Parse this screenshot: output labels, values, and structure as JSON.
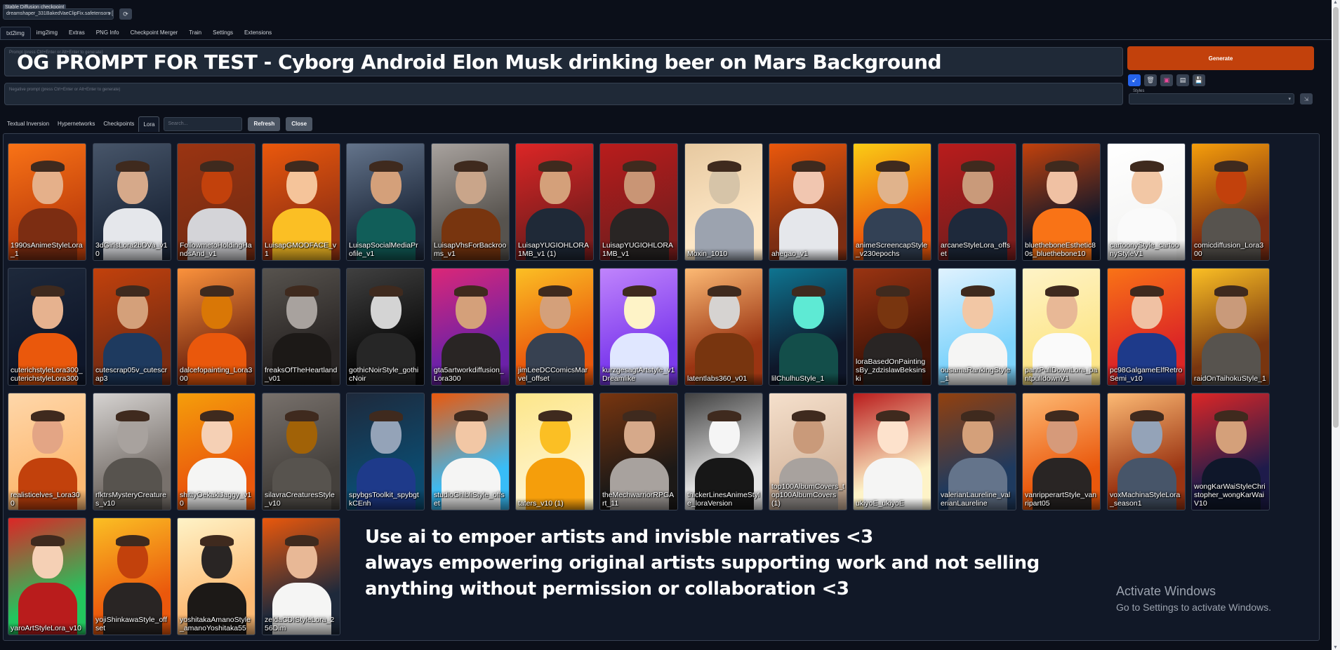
{
  "checkpoint": {
    "label": "Stable Diffusion checkpoint",
    "value": "dreamshaper_331BakedVaeClipFix.safetensors [",
    "refresh_icon": "refresh-icon"
  },
  "tabs": [
    "txt2img",
    "img2img",
    "Extras",
    "PNG Info",
    "Checkpoint Merger",
    "Train",
    "Settings",
    "Extensions"
  ],
  "prompt": {
    "placeholder": "Prompt (press Ctrl+Enter or Alt+Enter to generate)",
    "overlay_text": "OG PROMPT FOR TEST - Cyborg Android Elon Musk drinking beer on Mars Background"
  },
  "negative_prompt": {
    "placeholder": "Negative prompt (press Ctrl+Enter or Alt+Enter to generate)"
  },
  "generate_label": "Generate",
  "tool_icons": [
    "read-params-icon",
    "trash-icon",
    "extra-networks-icon",
    "clipboard-icon",
    "save-icon"
  ],
  "styles": {
    "label": "Styles",
    "value": ""
  },
  "networks": {
    "tabs": [
      "Textual Inversion",
      "Hypernetworks",
      "Checkpoints",
      "Lora"
    ],
    "search_placeholder": "Search...",
    "refresh_label": "Refresh",
    "close_label": "Close"
  },
  "cards": [
    {
      "name": "1990sAnimeStyleLora_1",
      "bg": "#c2410c",
      "bg2": "#f97316",
      "skin": "#e5b08a",
      "cloth": "#7c2d12"
    },
    {
      "name": "3dGirlsLora2bDVa_v10",
      "bg": "#1e293b",
      "bg2": "#475569",
      "skin": "#d6a98a",
      "cloth": "#e5e7eb"
    },
    {
      "name": "FollowmetoHoldingHandsAnd_v1",
      "bg": "#7c2d12",
      "bg2": "#9a3412",
      "skin": "#c2410c",
      "cloth": "#d4d4d8"
    },
    {
      "name": "LuisapGMODFACE_v1",
      "bg": "#9a3412",
      "bg2": "#ea580c",
      "skin": "#f5c49a",
      "cloth": "#fbbf24"
    },
    {
      "name": "LuisapSocialMediaProfile_v1",
      "bg": "#1e293b",
      "bg2": "#64748b",
      "skin": "#d4a07a",
      "cloth": "#115e59"
    },
    {
      "name": "LuisapVhsForBackrooms_v1",
      "bg": "#57534e",
      "bg2": "#a8a29e",
      "skin": "#c9a58a",
      "cloth": "#78350f"
    },
    {
      "name": "LuisapYUGIOHLORA1MB_v1 (1)",
      "bg": "#7f1d1d",
      "bg2": "#dc2626",
      "skin": "#d4a07a",
      "cloth": "#1f2937"
    },
    {
      "name": "LuisapYUGIOHLORA1MB_v1",
      "bg": "#7f1d1d",
      "bg2": "#b91c1c",
      "skin": "#c99575",
      "cloth": "#292524"
    },
    {
      "name": "Moxin_1010",
      "bg": "#fde7c6",
      "bg2": "#e7c9a0",
      "skin": "#d6c4a8",
      "cloth": "#9ca3af"
    },
    {
      "name": "ahegao_v1",
      "bg": "#7c2d12",
      "bg2": "#ea580c",
      "skin": "#f1c6b0",
      "cloth": "#e5e7eb"
    },
    {
      "name": "animeScreencapStyle_v230epochs",
      "bg": "#ea580c",
      "bg2": "#facc15",
      "skin": "#e0b38c",
      "cloth": "#334155"
    },
    {
      "name": "arcaneStyleLora_offset",
      "bg": "#7f1d1d",
      "bg2": "#b91c1c",
      "skin": "#c99a7a",
      "cloth": "#1e293b"
    },
    {
      "name": "bluetheboneEsthetic80s_bluethebone10",
      "bg": "#0f172a",
      "bg2": "#c2410c",
      "skin": "#f0c1a3",
      "cloth": "#f97316"
    },
    {
      "name": "cartoonyStyle_cartoonyStyleV1",
      "bg": "#f5f5f4",
      "bg2": "#ffffff",
      "skin": "#f2c7a5",
      "cloth": "#fafafa"
    },
    {
      "name": "comicdiffusion_Lora300",
      "bg": "#7c2d12",
      "bg2": "#f59e0b",
      "skin": "#c2410c",
      "cloth": "#57534e"
    },
    {
      "name": "cuterichstyleLora300_cuterichstyleLora300",
      "bg": "#0f172a",
      "bg2": "#1e293b",
      "skin": "#e6b28f",
      "cloth": "#ea580c"
    },
    {
      "name": "cutescrap05v_cutescrap3",
      "bg": "#7c2d12",
      "bg2": "#c2410c",
      "skin": "#d4a07a",
      "cloth": "#1e3a5f"
    },
    {
      "name": "dalcefopainting_Lora300",
      "bg": "#7c2d12",
      "bg2": "#fb923c",
      "skin": "#d97706",
      "cloth": "#ea580c"
    },
    {
      "name": "freaksOfTheHeartland_v01",
      "bg": "#292524",
      "bg2": "#57534e",
      "skin": "#a8a29e",
      "cloth": "#1c1917"
    },
    {
      "name": "gothicNoirStyle_gothicNoir",
      "bg": "#0a0a0a",
      "bg2": "#404040",
      "skin": "#d4d4d4",
      "cloth": "#262626"
    },
    {
      "name": "gta5artworkdiffusion_Lora300",
      "bg": "#6b21a8",
      "bg2": "#db2777",
      "skin": "#d4a07a",
      "cloth": "#292524"
    },
    {
      "name": "jimLeeDCComicsMarvel_offset",
      "bg": "#ea580c",
      "bg2": "#fbbf24",
      "skin": "#d4a07a",
      "cloth": "#374151"
    },
    {
      "name": "kurzgesagtArtstyle_v1Dreamlike",
      "bg": "#7c3aed",
      "bg2": "#c084fc",
      "skin": "#fef3c7",
      "cloth": "#e0e7ff"
    },
    {
      "name": "latentlabs360_v01",
      "bg": "#9a3412",
      "bg2": "#fdba74",
      "skin": "#d6d3d1",
      "cloth": "#78350f"
    },
    {
      "name": "lilChulhuStyle_1",
      "bg": "#0f172a",
      "bg2": "#0e7490",
      "skin": "#5eead4",
      "cloth": "#134e4a"
    },
    {
      "name": "loraBasedOnPaintingsBy_zdzislawBeksinski",
      "bg": "#431407",
      "bg2": "#9a3412",
      "skin": "#78350f",
      "cloth": "#292524"
    },
    {
      "name": "ousamaRankingStyle_1",
      "bg": "#7dd3fc",
      "bg2": "#e0f2fe",
      "skin": "#f2c7a5",
      "cloth": "#f5f5f4"
    },
    {
      "name": "pantPullDownLora_pantpulldownV1",
      "bg": "#fde68a",
      "bg2": "#fef3c7",
      "skin": "#e8b896",
      "cloth": "#fafafa"
    },
    {
      "name": "pc98GalgameElfRetroSemi_v10",
      "bg": "#dc2626",
      "bg2": "#f97316",
      "skin": "#f0c1a3",
      "cloth": "#1e3a8a"
    },
    {
      "name": "raidOnTaihokuStyle_1",
      "bg": "#78350f",
      "bg2": "#fbbf24",
      "skin": "#c99a7a",
      "cloth": "#57534e"
    },
    {
      "name": "realisticelves_Lora300",
      "bg": "#fdba74",
      "bg2": "#fed7aa",
      "skin": "#e3a585",
      "cloth": "#c2410c"
    },
    {
      "name": "rfktrsMysteryCreatures_v10",
      "bg": "#78716c",
      "bg2": "#d6d3d1",
      "skin": "#a8a29e",
      "cloth": "#57534e"
    },
    {
      "name": "shittyOekakiJaggy_v10",
      "bg": "#ea580c",
      "bg2": "#f59e0b",
      "skin": "#f5d0b5",
      "cloth": "#f5f5f4"
    },
    {
      "name": "silavraCreaturesStyle_v10",
      "bg": "#44403c",
      "bg2": "#78716c",
      "skin": "#a16207",
      "cloth": "#57534e"
    },
    {
      "name": "spybgsToolkit_spybgtkCEnh",
      "bg": "#0c4a6e",
      "bg2": "#1e293b",
      "skin": "#94a3b8",
      "cloth": "#1e3a8a"
    },
    {
      "name": "studioGhibliStyle_offset",
      "bg": "#38bdf8",
      "bg2": "#ea580c",
      "skin": "#f2c7a5",
      "cloth": "#f5f5f4"
    },
    {
      "name": "taters_v10 (1)",
      "bg": "#fef3c7",
      "bg2": "#fde68a",
      "skin": "#fbbf24",
      "cloth": "#f59e0b"
    },
    {
      "name": "theMechwarriorRPGArt_11",
      "bg": "#1c1917",
      "bg2": "#78350f",
      "skin": "#d6a98a",
      "cloth": "#a8a29e"
    },
    {
      "name": "thickerLinesAnimeStyle_loraVersion",
      "bg": "#e5e5e5",
      "bg2": "#404040",
      "skin": "#f5f5f5",
      "cloth": "#171717"
    },
    {
      "name": "top100AlbumCovers_top100AlbumCovers (1)",
      "bg": "#d6b8a0",
      "bg2": "#f5e0cc",
      "skin": "#c99a7a",
      "cloth": "#a8a29e"
    },
    {
      "name": "ukiyoE_ukiyoE",
      "bg": "#fef3c7",
      "bg2": "#b91c1c",
      "skin": "#fde2cc",
      "cloth": "#f5f5f4"
    },
    {
      "name": "valerianLaureline_valerianLaureline",
      "bg": "#1e3a5f",
      "bg2": "#92400e",
      "skin": "#d4a07a",
      "cloth": "#64748b"
    },
    {
      "name": "vanripperartStyle_vanripart05",
      "bg": "#ea580c",
      "bg2": "#fdba74",
      "skin": "#d69a7a",
      "cloth": "#292524"
    },
    {
      "name": "voxMachinaStyleLora_season1",
      "bg": "#9a3412",
      "bg2": "#fdba74",
      "skin": "#94a3b8",
      "cloth": "#475569"
    },
    {
      "name": "wongKarWaiStyleChristopher_wongKarWaiV10",
      "bg": "#1e1b4b",
      "bg2": "#dc2626",
      "skin": "#d4a07a",
      "cloth": "#0f172a"
    },
    {
      "name": "yaroArtStyleLora_v10",
      "bg": "#22c55e",
      "bg2": "#dc2626",
      "skin": "#f5d0b5",
      "cloth": "#b91c1c"
    },
    {
      "name": "yojiShinkawaStyle_offset",
      "bg": "#ea580c",
      "bg2": "#fbbf24",
      "skin": "#c2410c",
      "cloth": "#292524"
    },
    {
      "name": "yoshitakaAmanoStyle_amanoYoshitaka55",
      "bg": "#fdba74",
      "bg2": "#fef3c7",
      "skin": "#292524",
      "cloth": "#1c1917"
    },
    {
      "name": "zeldaCDIStyleLora_256Dim",
      "bg": "#1e293b",
      "bg2": "#ea580c",
      "skin": "#e8b896",
      "cloth": "#f5f5f4"
    }
  ],
  "overlay_lines": [
    "Use ai to empoer artists and invisble narratives <3",
    "always empowering original artists supporting work and not selling",
    "anything without permission or collaboration <3"
  ],
  "watermark": {
    "title": "Activate Windows",
    "subtitle": "Go to Settings to activate Windows."
  }
}
